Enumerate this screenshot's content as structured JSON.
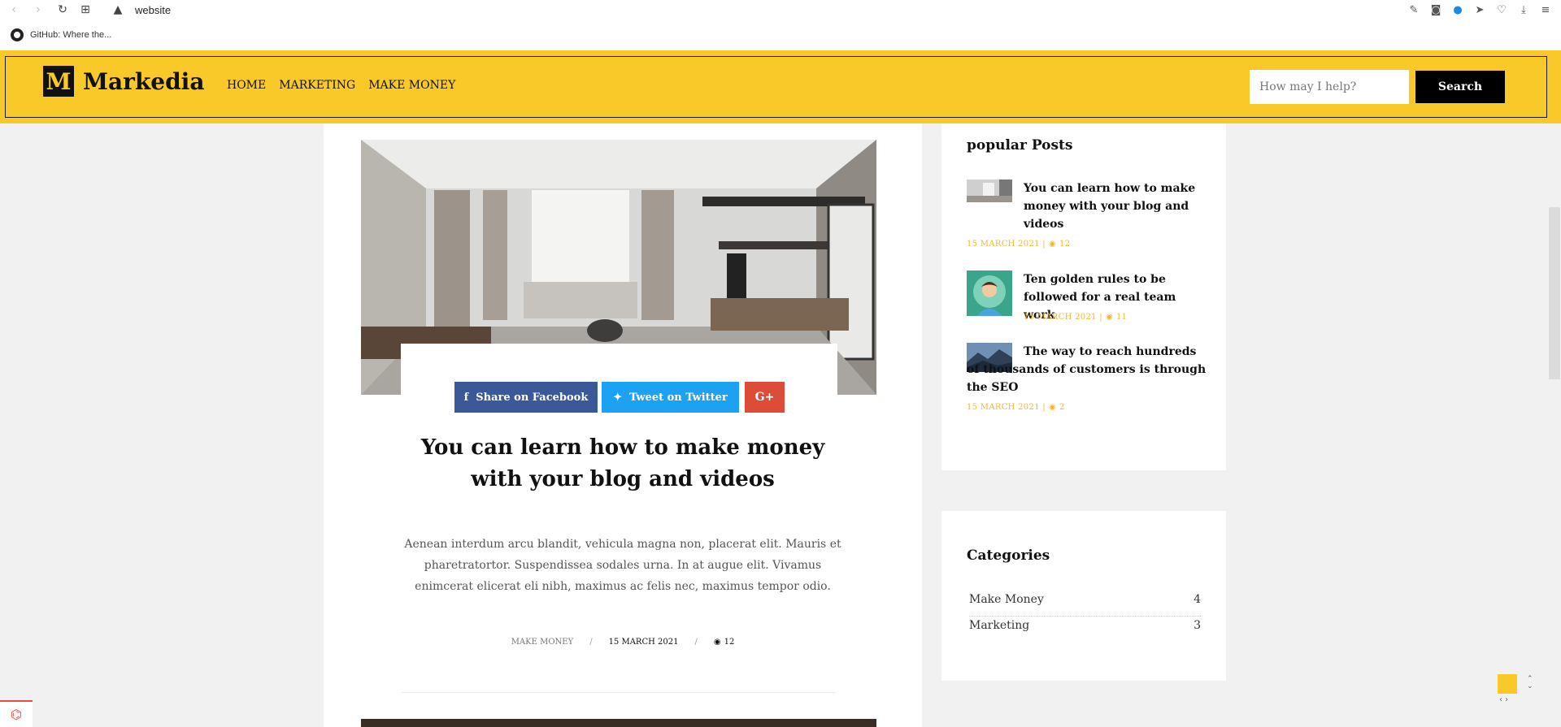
{
  "browser": {
    "url": "website",
    "bookmark": "GitHub: Where the..."
  },
  "header": {
    "logo_letter": "M",
    "logo_text": "Markedia",
    "nav": [
      "HOME",
      "MARKETING",
      "MAKE MONEY"
    ],
    "search_placeholder": "How may I help?",
    "search_button": "Search",
    "accent_color": "#f8c928"
  },
  "article": {
    "share_facebook": "Share on Facebook",
    "share_twitter": "Tweet on Twitter",
    "share_google": "G+",
    "title": "You can learn how to make money with your blog and videos",
    "excerpt": "Aenean interdum arcu blandit, vehicula magna non, placerat elit. Mauris et pharetratortor. Suspendissea sodales urna. In at augue elit. Vivamus enimcerat elicerat eli nibh, maximus ac felis nec, maximus tempor odio.",
    "category": "MAKE MONEY",
    "separator": "/",
    "date": "15 MARCH 2021",
    "views": "12"
  },
  "popular": {
    "title": "popular Posts",
    "posts": [
      {
        "title": "You can learn how to make money with your blog and videos",
        "meta": "15 MARCH 2021 |",
        "views": "12"
      },
      {
        "title": "Ten golden rules to be followed for a real team work",
        "meta": "15 MARCH 2021 |",
        "views": "11"
      },
      {
        "title": "The way to reach hundreds of thousands of customers is through the SEO",
        "meta": "15 MARCH 2021 |",
        "views": "2"
      }
    ]
  },
  "categories": {
    "title": "Categories",
    "items": [
      {
        "name": "Make Money",
        "count": "4"
      },
      {
        "name": "Marketing",
        "count": "3"
      }
    ]
  }
}
